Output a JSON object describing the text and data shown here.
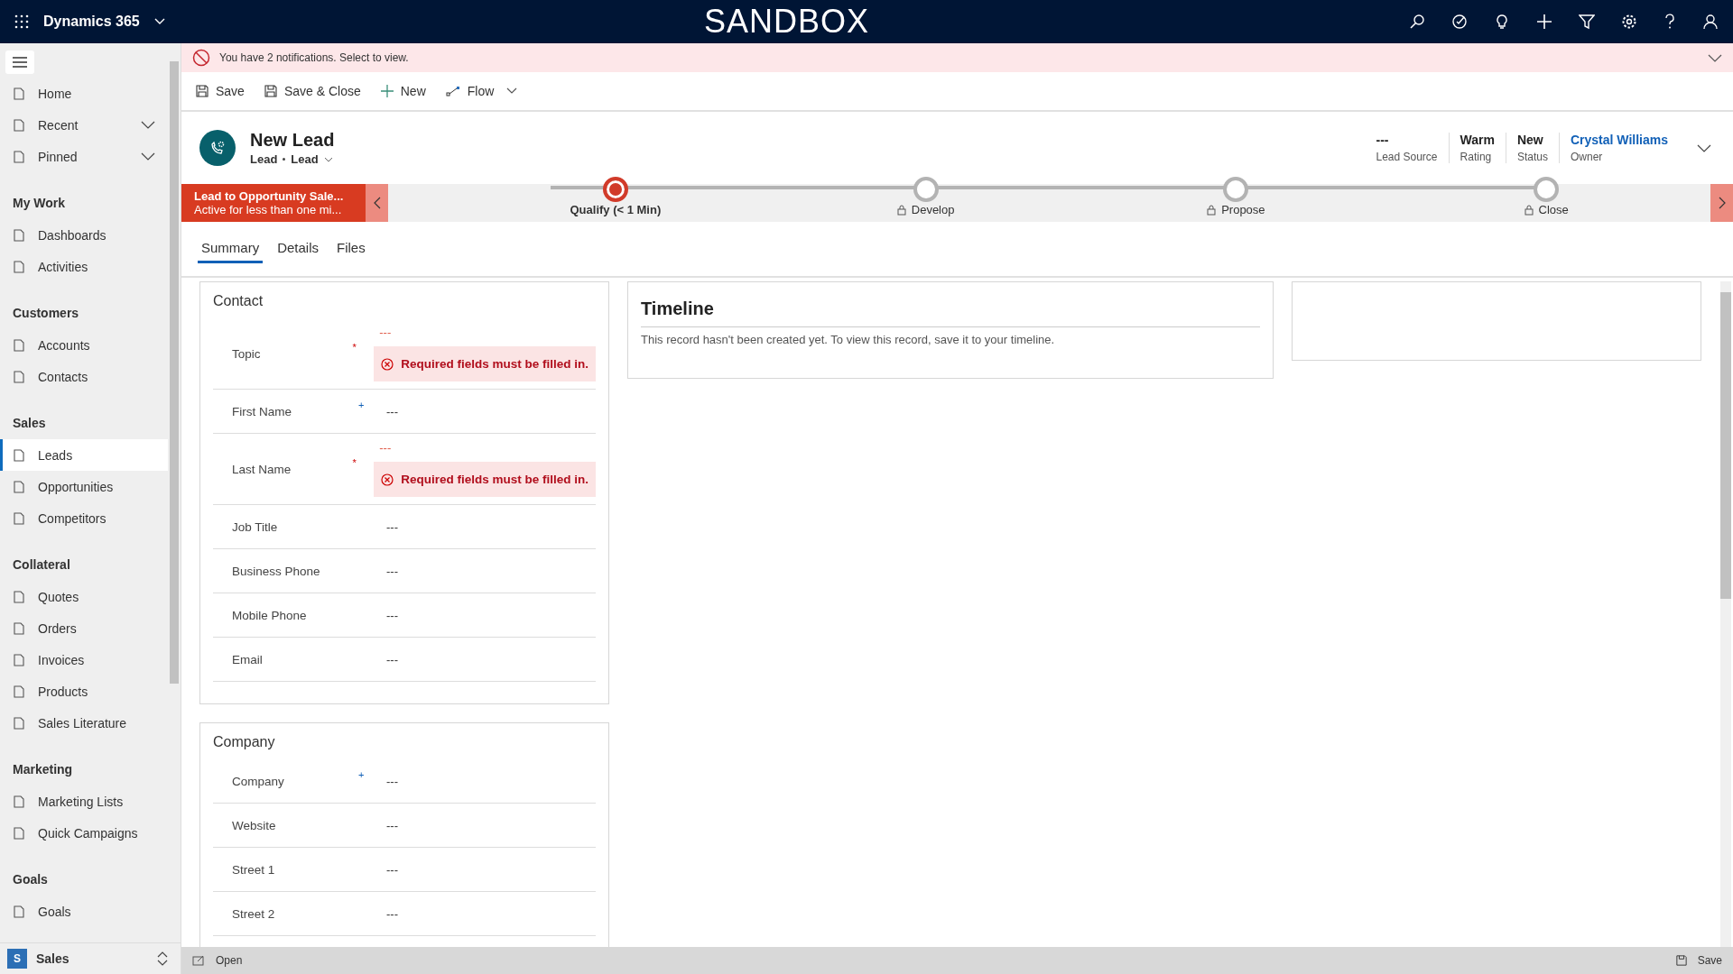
{
  "top_bar": {
    "app_name": "Dynamics 365",
    "environment": "SANDBOX"
  },
  "notification": {
    "text": "You have 2 notifications. Select to view."
  },
  "command_bar": [
    {
      "label": "Save",
      "kind": "save"
    },
    {
      "label": "Save & Close",
      "kind": "save_close"
    },
    {
      "label": "New",
      "kind": "new"
    },
    {
      "label": "Flow",
      "kind": "flow"
    }
  ],
  "record": {
    "title": "New Lead",
    "entity": "Lead",
    "form": "Lead",
    "header_fields": [
      {
        "value": "---",
        "label": "Lead Source",
        "link": false
      },
      {
        "value": "Warm",
        "label": "Rating",
        "link": false
      },
      {
        "value": "New",
        "label": "Status",
        "link": false
      },
      {
        "value": "Crystal Williams",
        "label": "Owner",
        "link": true
      }
    ]
  },
  "process": {
    "name": "Lead to Opportunity Sale...",
    "status": "Active for less than one mi...",
    "stages": [
      {
        "label": "Qualify  (< 1 Min)",
        "selected": true,
        "locked": false
      },
      {
        "label": "Develop",
        "selected": false,
        "locked": true
      },
      {
        "label": "Propose",
        "selected": false,
        "locked": true
      },
      {
        "label": "Close",
        "selected": false,
        "locked": true
      }
    ]
  },
  "tabs": [
    {
      "label": "Summary",
      "selected": true
    },
    {
      "label": "Details",
      "selected": false
    },
    {
      "label": "Files",
      "selected": false
    }
  ],
  "sections": [
    {
      "title": "Contact",
      "fields": [
        {
          "label": "Topic",
          "value": "---",
          "marker": "*",
          "required": true,
          "error": "Required fields must be filled in."
        },
        {
          "label": "First Name",
          "value": "---",
          "marker": "+",
          "required": false
        },
        {
          "label": "Last Name",
          "value": "---",
          "marker": "*",
          "required": true,
          "error": "Required fields must be filled in."
        },
        {
          "label": "Job Title",
          "value": "---"
        },
        {
          "label": "Business Phone",
          "value": "---"
        },
        {
          "label": "Mobile Phone",
          "value": "---"
        },
        {
          "label": "Email",
          "value": "---"
        }
      ]
    },
    {
      "title": "Company",
      "fields": [
        {
          "label": "Company",
          "value": "---",
          "marker": "+",
          "required": false
        },
        {
          "label": "Website",
          "value": "---"
        },
        {
          "label": "Street 1",
          "value": "---"
        },
        {
          "label": "Street 2",
          "value": "---"
        }
      ]
    }
  ],
  "timeline": {
    "title": "Timeline",
    "message": "This record hasn't been created yet.  To view this record, save it to your timeline."
  },
  "sidebar": {
    "top_items": [
      {
        "label": "Home",
        "expandable": false
      },
      {
        "label": "Recent",
        "expandable": true
      },
      {
        "label": "Pinned",
        "expandable": true
      }
    ],
    "groups": [
      {
        "title": "My Work",
        "items": [
          {
            "label": "Dashboards",
            "selected": false
          },
          {
            "label": "Activities",
            "selected": false
          }
        ]
      },
      {
        "title": "Customers",
        "items": [
          {
            "label": "Accounts",
            "selected": false
          },
          {
            "label": "Contacts",
            "selected": false
          }
        ]
      },
      {
        "title": "Sales",
        "items": [
          {
            "label": "Leads",
            "selected": true
          },
          {
            "label": "Opportunities",
            "selected": false
          },
          {
            "label": "Competitors",
            "selected": false
          }
        ]
      },
      {
        "title": "Collateral",
        "items": [
          {
            "label": "Quotes",
            "selected": false
          },
          {
            "label": "Orders",
            "selected": false
          },
          {
            "label": "Invoices",
            "selected": false
          },
          {
            "label": "Products",
            "selected": false
          },
          {
            "label": "Sales Literature",
            "selected": false
          }
        ]
      },
      {
        "title": "Marketing",
        "items": [
          {
            "label": "Marketing Lists",
            "selected": false
          },
          {
            "label": "Quick Campaigns",
            "selected": false
          }
        ]
      },
      {
        "title": "Goals",
        "items": [
          {
            "label": "Goals",
            "selected": false
          }
        ]
      }
    ],
    "area": {
      "initial": "S",
      "label": "Sales"
    }
  },
  "status_bar": {
    "left": "Open",
    "right": "Save"
  }
}
